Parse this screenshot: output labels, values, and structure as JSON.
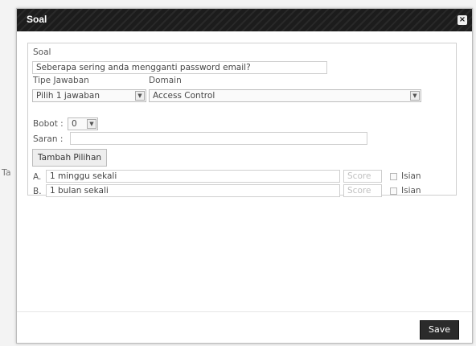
{
  "background": {
    "fragment_1": "Ta"
  },
  "dialog": {
    "title": "Soal",
    "close_label": "×",
    "soal_label": "Soal",
    "soal_value": "Seberapa sering anda mengganti password email?",
    "tipe_jawaban_label": "Tipe Jawaban",
    "tipe_jawaban_value": "Pilih 1 jawaban",
    "domain_label": "Domain",
    "domain_value": "Access Control",
    "bobot_label": "Bobot :",
    "bobot_value": "0",
    "saran_label": "Saran :",
    "saran_value": "",
    "tambah_pilihan_label": "Tambah Pilihan",
    "choices": [
      {
        "prefix": "A.",
        "value": "1 minggu sekali",
        "score_placeholder": "Score",
        "isian_label": "Isian"
      },
      {
        "prefix": "B.",
        "value": "1 bulan sekali",
        "score_placeholder": "Score",
        "isian_label": "Isian"
      }
    ],
    "save_label": "Save"
  },
  "colors": {
    "titlebar": "#1c1c1c",
    "save_button": "#2b2b2b"
  }
}
